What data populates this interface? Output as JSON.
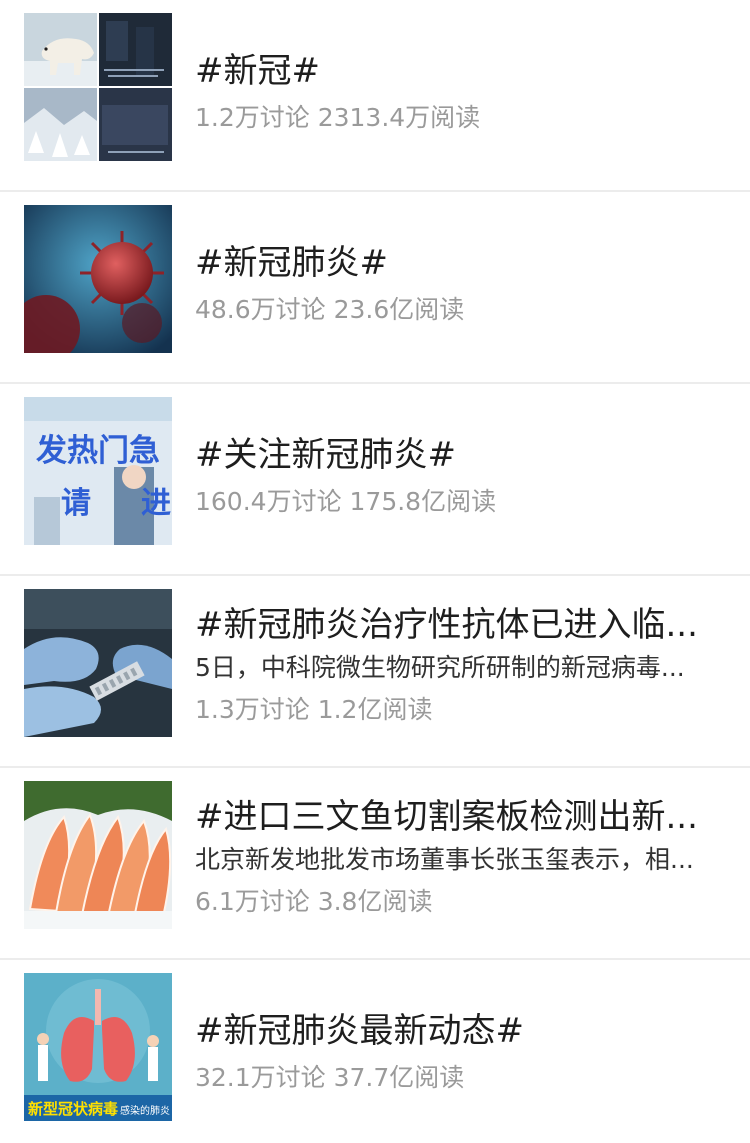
{
  "topics": [
    {
      "title": "#新冠#",
      "desc": "",
      "stats": "1.2万讨论 2313.4万阅读",
      "thumb_icon": "polar-bear-collage-thumbnail"
    },
    {
      "title": "#新冠肺炎#",
      "desc": "",
      "stats": "48.6万讨论 23.6亿阅读",
      "thumb_icon": "virus-thumbnail"
    },
    {
      "title": "#关注新冠肺炎#",
      "desc": "",
      "stats": "160.4万讨论 175.8亿阅读",
      "thumb_icon": "fever-clinic-thumbnail",
      "thumb_text": [
        "发热门急",
        "请",
        "进"
      ]
    },
    {
      "title": "#新冠肺炎治疗性抗体已进入临...",
      "desc": "5日，中科院微生物研究所研制的新冠病毒...",
      "stats": "1.3万讨论 1.2亿阅读",
      "thumb_icon": "gloved-hands-lab-thumbnail"
    },
    {
      "title": "#进口三文鱼切割案板检测出新...",
      "desc": "北京新发地批发市场董事长张玉玺表示，相...",
      "stats": "6.1万讨论 3.8亿阅读",
      "thumb_icon": "salmon-slices-thumbnail"
    },
    {
      "title": "#新冠肺炎最新动态#",
      "desc": "",
      "stats": "32.1万讨论 37.7亿阅读",
      "thumb_icon": "lungs-illustration-thumbnail",
      "thumb_text": [
        "新型冠状病毒",
        "感染的肺炎"
      ]
    }
  ],
  "colors": {
    "title": "#1e1e1e",
    "desc": "#333333",
    "stats": "#9a9a9a",
    "divider": "#ececec"
  }
}
